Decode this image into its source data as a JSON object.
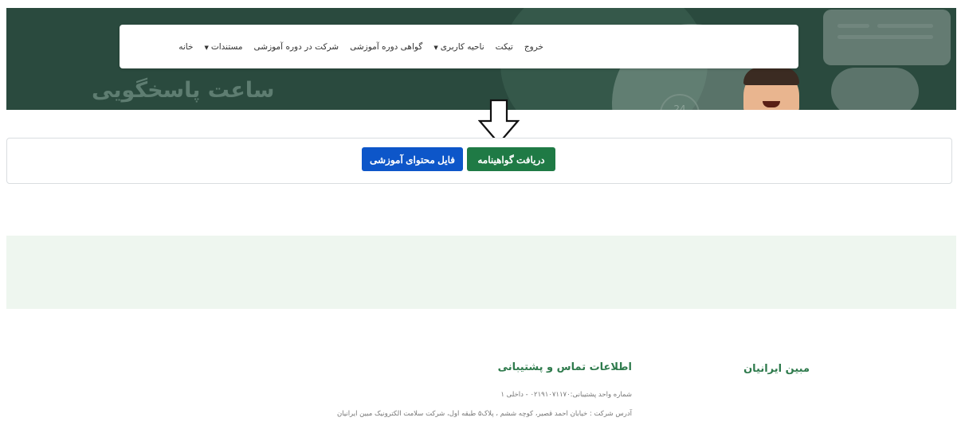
{
  "hero": {
    "title": "ساعت پاسخگویی",
    "clock_text": "24"
  },
  "nav": {
    "items": [
      {
        "label": "خانه",
        "dropdown": false
      },
      {
        "label": "مستندات",
        "dropdown": true
      },
      {
        "label": "شرکت در دوره آموزشی",
        "dropdown": false
      },
      {
        "label": "گواهی دوره آموزشی",
        "dropdown": false
      },
      {
        "label": "ناحیه کاربری",
        "dropdown": true
      },
      {
        "label": "تیکت",
        "dropdown": false
      },
      {
        "label": "خروج",
        "dropdown": false
      }
    ]
  },
  "actions": {
    "certificate_label": "دریافت گواهینامه",
    "content_file_label": "فایل محتوای آموزشی"
  },
  "footer": {
    "company_name": "مبین ایرانیان",
    "contact_title": "اطلاعات تماس و پشتیبانی",
    "phone_line": "شماره واحد پشتیبانی:۰۲۱۹۱۰۷۱۱۷۰ - داخلی ۱",
    "address_line": "آدرس شرکت : خیابان احمد قصیر، کوچه ششم ، پلاک۵ طبقه اول، شرکت سلامت الکترونیک مبین ایرانیان"
  },
  "colors": {
    "hero_bg": "#2a4a3e",
    "primary_green": "#1f7a45",
    "primary_blue": "#0d56c9",
    "band_bg": "#eef6ef"
  }
}
